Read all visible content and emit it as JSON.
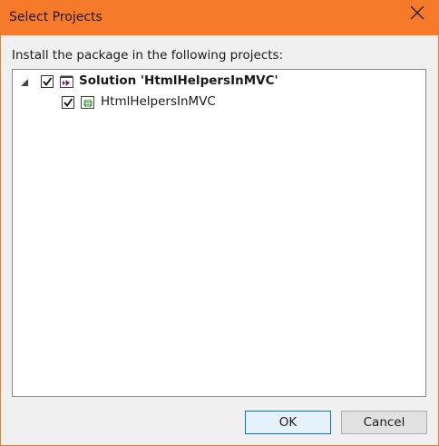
{
  "dialog": {
    "title": "Select Projects",
    "accent_color": "#f7792a"
  },
  "instruction": "Install the package in the following projects:",
  "tree": {
    "solution": {
      "label": "Solution 'HtmlHelpersInMVC'",
      "checked": true,
      "expanded": true,
      "icon": "solution-icon"
    },
    "projects": [
      {
        "label": "HtmlHelpersInMVC",
        "checked": true,
        "icon": "web-project-icon"
      }
    ]
  },
  "buttons": {
    "ok_label": "OK",
    "cancel_label": "Cancel"
  }
}
